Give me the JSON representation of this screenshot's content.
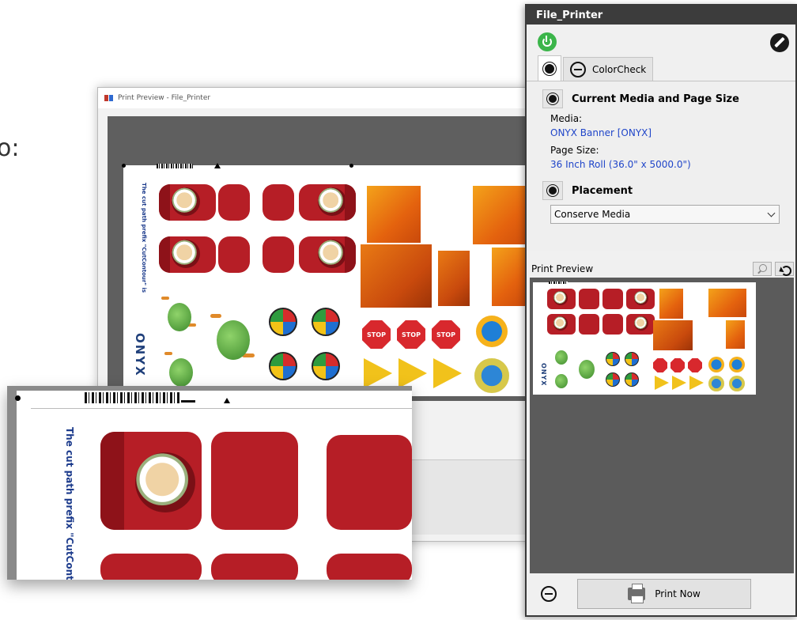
{
  "intro": {
    "text": "o:"
  },
  "print_preview_window": {
    "title": "Print Preview - File_Printer"
  },
  "sheet_labels": {
    "brand": "ONYX",
    "cut_path_note": "The cut path prefix \"CutContour\" is",
    "stop_sign": "STOP"
  },
  "file_printer": {
    "title": "File_Printer",
    "icons": {
      "power": "power-icon",
      "edit": "edit-pencil-icon"
    },
    "tabs": [
      {
        "label": "",
        "icon": "gear-icon",
        "active": true
      },
      {
        "label": "ColorCheck",
        "icon": "minus-circle-icon",
        "active": false
      }
    ],
    "media_section": {
      "heading": "Current Media and Page Size",
      "media_label": "Media:",
      "media_value": "ONYX Banner [ONYX]",
      "page_size_label": "Page Size:",
      "page_size_value": "36 Inch Roll (36.0\" x 5000.0\")"
    },
    "placement_section": {
      "heading": "Placement",
      "selected": "Conserve Media"
    },
    "print_preview": {
      "label": "Print Preview"
    },
    "footer": {
      "print_now_label": "Print Now"
    },
    "colors": {
      "title_bar": "#3c3c3c",
      "link_blue": "#1f45c9",
      "power_green": "#3bb54a"
    }
  }
}
